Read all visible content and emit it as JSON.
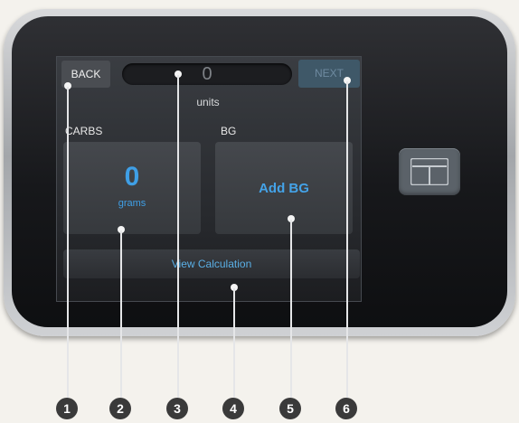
{
  "header": {
    "back_label": "BACK",
    "units_value": "0",
    "units_label": "units",
    "next_label": "NEXT"
  },
  "carbs": {
    "label": "CARBS",
    "value": "0",
    "unit": "grams"
  },
  "bg": {
    "label": "BG",
    "action": "Add BG"
  },
  "view_calculation_label": "View Calculation",
  "callouts": [
    "1",
    "2",
    "3",
    "4",
    "5",
    "6"
  ],
  "colors": {
    "accent_blue": "#3f9fe6",
    "screen_bg": "#2b2d31",
    "callout_bg": "#3a3a3a"
  },
  "icons": {
    "device_button": "t-logo-icon"
  }
}
